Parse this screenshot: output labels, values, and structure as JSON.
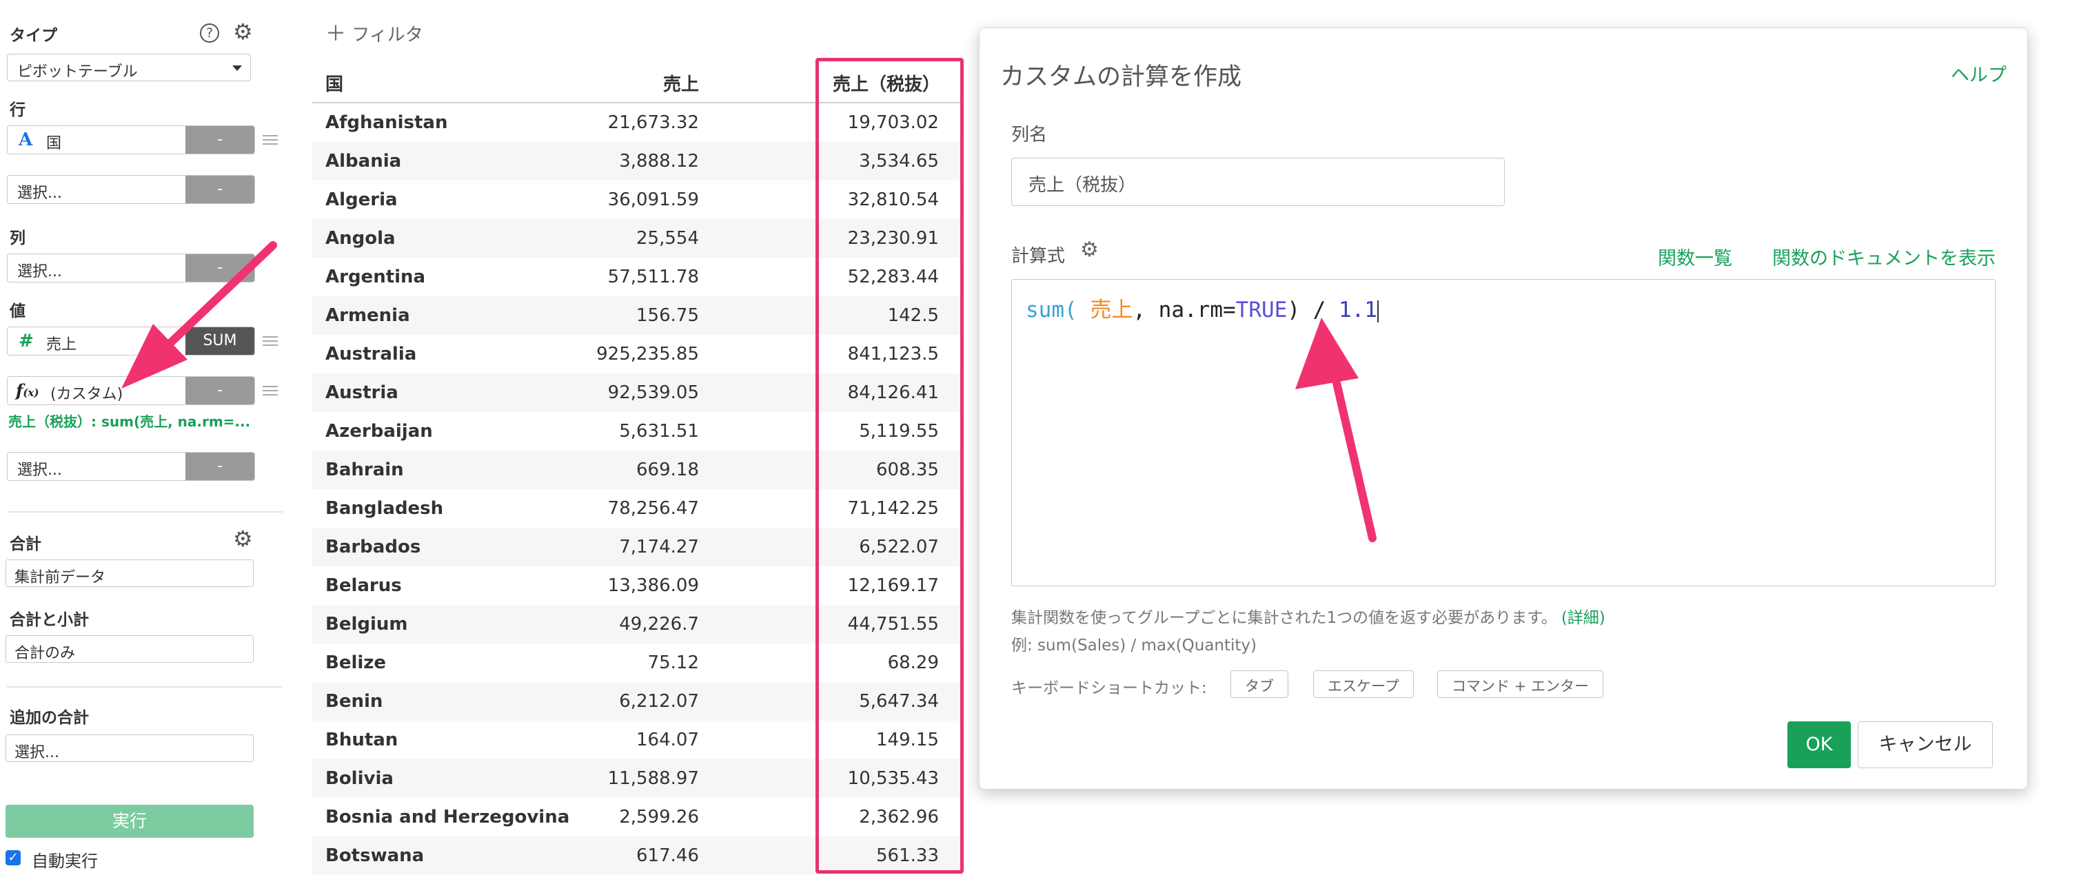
{
  "sidebar": {
    "type_label": "タイプ",
    "type_value": "ピボットテーブル",
    "rows_label": "行",
    "rows_field": "国",
    "rows_select": "選択...",
    "cols_label": "列",
    "cols_select": "選択...",
    "values_label": "値",
    "value_field": "売上",
    "value_agg": "SUM",
    "custom_field": "(カスタム)",
    "custom_desc": "売上（税抜）: sum(売上, na.rm=...",
    "values_select": "選択...",
    "minus": "-",
    "total_label": "合計",
    "total_value": "集計前データ",
    "subtotal_label": "合計と小計",
    "subtotal_value": "合計のみ",
    "extra_total_label": "追加の合計",
    "extra_total_placeholder": "選択...",
    "run_button": "実行",
    "auto_run_label": "自動実行"
  },
  "table": {
    "filter_button": "フィルタ",
    "headers": [
      "国",
      "売上",
      "売上（税抜）"
    ],
    "rows": [
      [
        "Afghanistan",
        "21,673.32",
        "19,703.02"
      ],
      [
        "Albania",
        "3,888.12",
        "3,534.65"
      ],
      [
        "Algeria",
        "36,091.59",
        "32,810.54"
      ],
      [
        "Angola",
        "25,554",
        "23,230.91"
      ],
      [
        "Argentina",
        "57,511.78",
        "52,283.44"
      ],
      [
        "Armenia",
        "156.75",
        "142.5"
      ],
      [
        "Australia",
        "925,235.85",
        "841,123.5"
      ],
      [
        "Austria",
        "92,539.05",
        "84,126.41"
      ],
      [
        "Azerbaijan",
        "5,631.51",
        "5,119.55"
      ],
      [
        "Bahrain",
        "669.18",
        "608.35"
      ],
      [
        "Bangladesh",
        "78,256.47",
        "71,142.25"
      ],
      [
        "Barbados",
        "7,174.27",
        "6,522.07"
      ],
      [
        "Belarus",
        "13,386.09",
        "12,169.17"
      ],
      [
        "Belgium",
        "49,226.7",
        "44,751.55"
      ],
      [
        "Belize",
        "75.12",
        "68.29"
      ],
      [
        "Benin",
        "6,212.07",
        "5,647.34"
      ],
      [
        "Bhutan",
        "164.07",
        "149.15"
      ],
      [
        "Bolivia",
        "11,588.97",
        "10,535.43"
      ],
      [
        "Bosnia and Herzegovina",
        "2,599.26",
        "2,362.96"
      ],
      [
        "Botswana",
        "617.46",
        "561.33"
      ]
    ]
  },
  "dialog": {
    "title": "カスタムの計算を作成",
    "help_link": "ヘルプ",
    "column_name_label": "列名",
    "column_name_value": "売上（税抜）",
    "formula_label": "計算式",
    "function_list_link": "関数一覧",
    "function_docs_link": "関数のドキュメントを表示",
    "code_fn": "sum",
    "code_paren_open": "(",
    "code_field": " 売上",
    "code_middle": ", na.rm=",
    "code_true": "TRUE",
    "code_close": ") / ",
    "code_number": "1.1",
    "hint_text": "集計関数を使ってグループごとに集計された1つの値を返す必要があります。",
    "hint_link": "(詳細)",
    "example_text": "例: sum(Sales) / max(Quantity)",
    "shortcut_label": "キーボードショートカット:",
    "shortcut_tab": "タブ",
    "shortcut_escape": "エスケープ",
    "shortcut_cmd_enter": "コマンド + エンター",
    "ok_button": "OK",
    "cancel_button": "キャンセル"
  },
  "colors": {
    "accent_green": "#19a15a",
    "highlight_pink": "#e8336d",
    "code_blue": "#3aa0d8",
    "code_orange": "#f08a24",
    "code_purple": "#5a4fd6"
  }
}
